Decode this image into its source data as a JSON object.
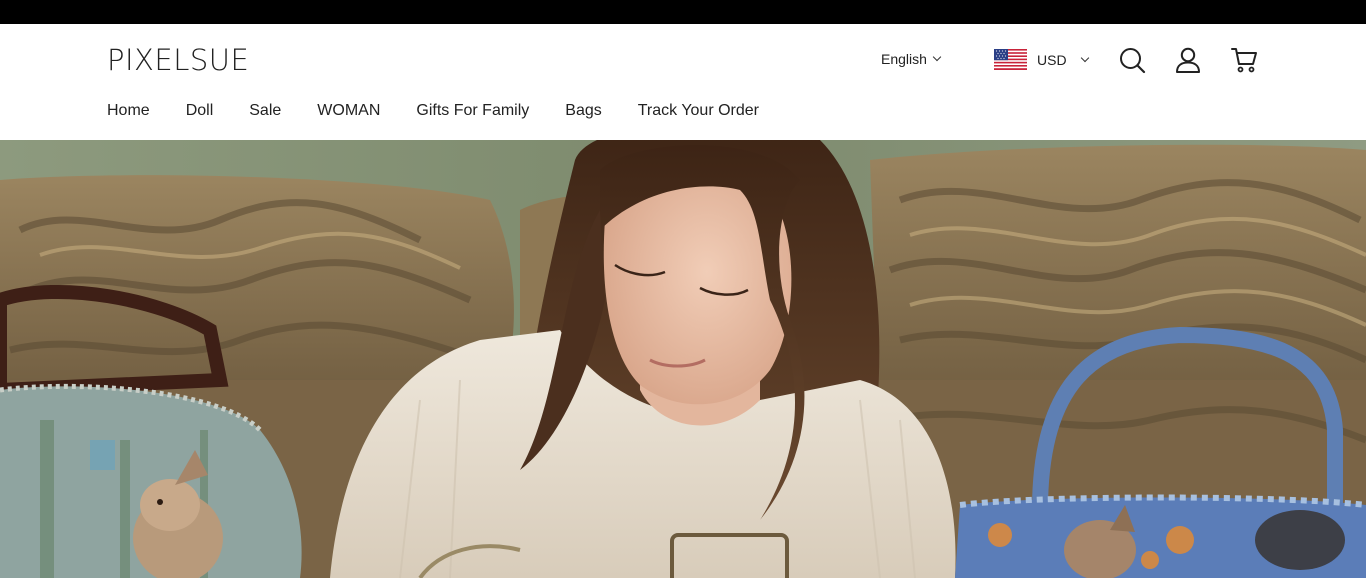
{
  "brand": {
    "logo_text": "PIXELSUE"
  },
  "header": {
    "language": {
      "selected": "English",
      "icon": "chevron-down-icon"
    },
    "currency": {
      "selected": "USD",
      "flag": "us-flag-icon",
      "icon": "chevron-down-icon"
    },
    "actions": [
      {
        "name": "search",
        "icon": "search-icon"
      },
      {
        "name": "account",
        "icon": "user-icon"
      },
      {
        "name": "cart",
        "icon": "cart-icon"
      }
    ]
  },
  "nav": {
    "items": [
      {
        "label": "Home"
      },
      {
        "label": "Doll"
      },
      {
        "label": "Sale"
      },
      {
        "label": "WOMAN"
      },
      {
        "label": "Gifts For Family"
      },
      {
        "label": "Bags"
      },
      {
        "label": "Track Your Order"
      }
    ]
  },
  "hero": {
    "image": "hero-photo",
    "colors": {
      "sofa": "#8a7352",
      "skin": "#e6bda6",
      "hair": "#4a2d1c",
      "sweater": "#e9e1d4",
      "bag_blue": "#5b7db8"
    }
  }
}
